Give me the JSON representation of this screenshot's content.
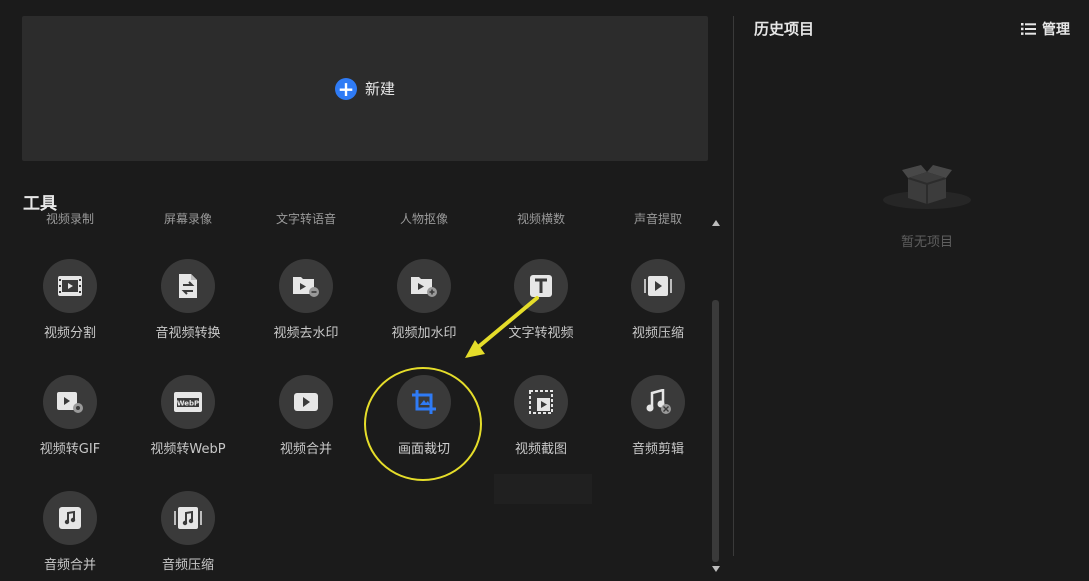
{
  "new_project": {
    "label": "新建"
  },
  "tools_section": {
    "title": "工具",
    "cut_row": [
      "视频录制",
      "屏幕录像",
      "文字转语音",
      "人物抠像",
      "视频横数",
      "声音提取"
    ],
    "items": [
      {
        "label": "视频分割",
        "icon": "film-strip-icon"
      },
      {
        "label": "音视频转换",
        "icon": "file-convert-icon"
      },
      {
        "label": "视频去水印",
        "icon": "video-folder-remove-icon"
      },
      {
        "label": "视频加水印",
        "icon": "video-folder-add-icon"
      },
      {
        "label": "文字转视频",
        "icon": "text-t-icon"
      },
      {
        "label": "视频压缩",
        "icon": "video-compress-icon"
      },
      {
        "label": "视频转GIF",
        "icon": "video-gif-icon"
      },
      {
        "label": "视频转WebP",
        "icon": "webp-icon"
      },
      {
        "label": "视频合并",
        "icon": "play-box-icon"
      },
      {
        "label": "画面裁切",
        "icon": "crop-icon"
      },
      {
        "label": "视频截图",
        "icon": "screenshot-icon"
      },
      {
        "label": "音频剪辑",
        "icon": "audio-clip-icon"
      },
      {
        "label": "音频合并",
        "icon": "audio-merge-icon"
      },
      {
        "label": "音频压缩",
        "icon": "audio-compress-icon"
      }
    ]
  },
  "history": {
    "title": "历史项目",
    "manage_label": "管理",
    "empty_text": "暂无项目"
  },
  "colors": {
    "accent": "#2f7bf5",
    "highlight_ring": "#e5dd2a",
    "arrow": "#e5dd2a"
  }
}
